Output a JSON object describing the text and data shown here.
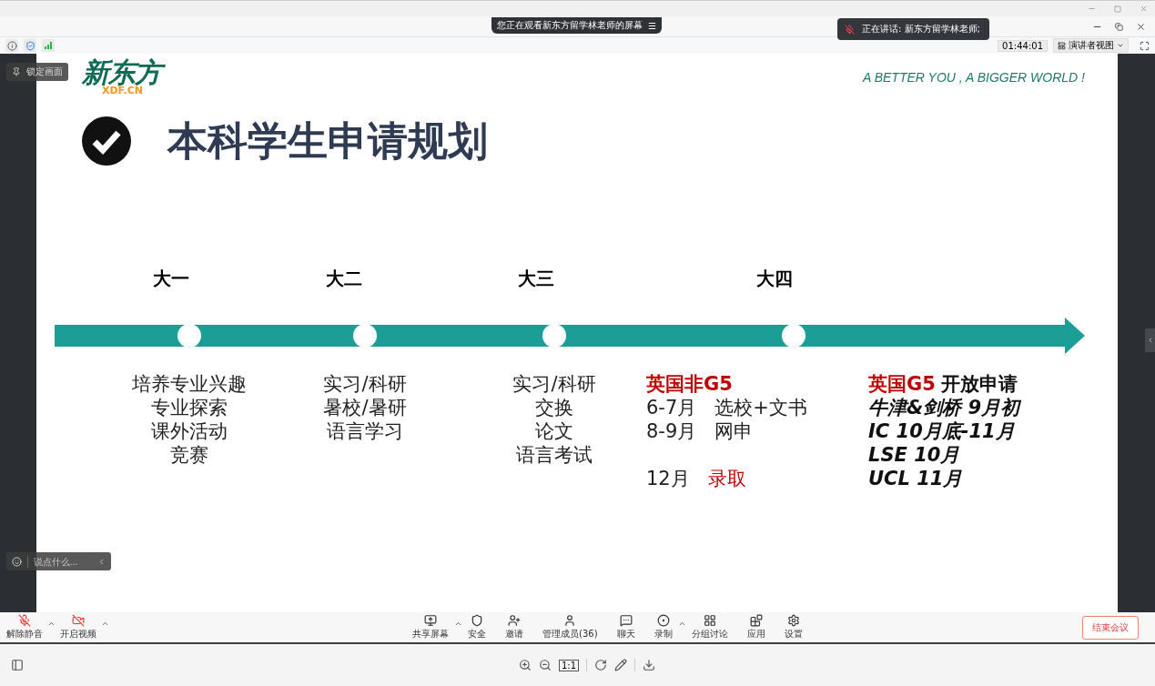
{
  "share_banner": {
    "text": "您正在观看新东方留学林老师的屏幕",
    "menu_glyph": "☰"
  },
  "speaker_toast": {
    "text": "正在讲话: 新东方留学林老师;"
  },
  "info_bar": {
    "timer": "01:44:01",
    "view_label": "演讲者视图"
  },
  "overlays": {
    "lock_label": "锁定画面",
    "chat_placeholder": "说点什么..."
  },
  "slide": {
    "logo": "新东方",
    "logo_sub": "XDF.CN",
    "slogan": "A BETTER YOU , A BIGGER WORLD !",
    "title": "本科学生申请规划",
    "years": [
      "大一",
      "大二",
      "大三",
      "大四"
    ],
    "columns": [
      {
        "kind": "plain",
        "lines": [
          "培养专业兴趣",
          "专业探索",
          "课外活动",
          "竞赛"
        ]
      },
      {
        "kind": "plain",
        "lines": [
          "实习/科研",
          "暑校/暑研",
          "语言学习"
        ]
      },
      {
        "kind": "plain",
        "lines": [
          "实习/科研",
          "交换",
          "论文",
          "语言考试"
        ]
      },
      {
        "kind": "schedule",
        "heading": [
          {
            "text": "英国非G5",
            "highlight": true
          }
        ],
        "rows": [
          {
            "label": "6-7月",
            "value": "选校+文书",
            "highlight": false,
            "gap_before": false
          },
          {
            "label": "8-9月",
            "value": "网申",
            "highlight": false,
            "gap_before": false
          },
          {
            "label": "12月",
            "value": "录取",
            "highlight": true,
            "gap_before": true
          }
        ]
      },
      {
        "kind": "deadlines",
        "heading": [
          {
            "text": "英国G5",
            "highlight": true
          },
          {
            "text": "开放申请",
            "highlight": false
          }
        ],
        "lines": [
          "牛津&剑桥 9月初",
          "IC 10月底-11月",
          "LSE 10月",
          "UCL 11月"
        ]
      }
    ]
  },
  "toolbar": {
    "left": [
      {
        "label": "解除静音",
        "caret": true
      },
      {
        "label": "开启视频",
        "caret": true
      }
    ],
    "center": [
      {
        "label": "共享屏幕",
        "caret": true
      },
      {
        "label": "安全",
        "caret": false
      },
      {
        "label": "邀请",
        "caret": false
      },
      {
        "label": "管理成员(36)",
        "caret": false
      },
      {
        "label": "聊天",
        "caret": false
      },
      {
        "label": "录制",
        "caret": true
      },
      {
        "label": "分组讨论",
        "caret": false
      },
      {
        "label": "应用",
        "caret": false
      },
      {
        "label": "设置",
        "caret": false
      }
    ],
    "end_button": "结束会议"
  },
  "viewer_bar": {
    "actual_size": "1:1"
  }
}
